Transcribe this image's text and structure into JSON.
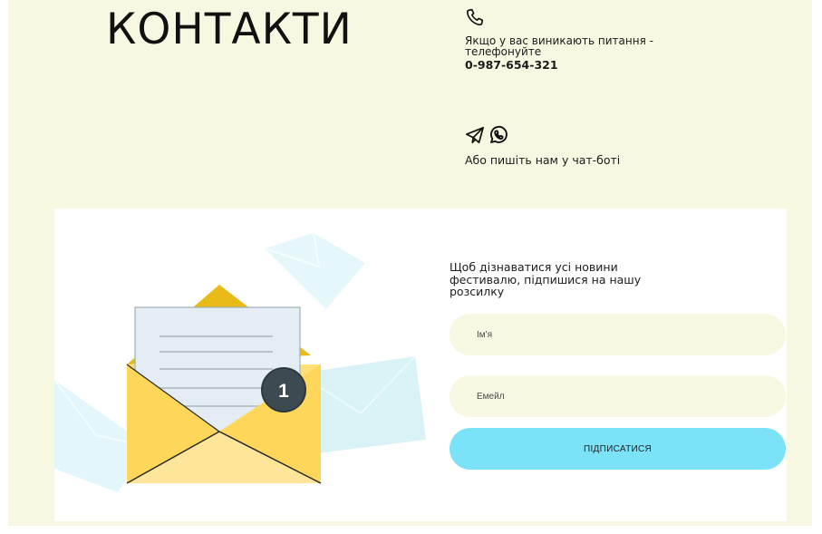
{
  "page": {
    "title": "КОНТАКТИ"
  },
  "contacts": {
    "phone_icon": "phone-icon",
    "phone_text_line1": "Якщо у вас виникають питання -",
    "phone_text_line2": "телефонуйте",
    "phone_number": "0-987-654-321",
    "chat_icons": [
      "telegram-icon",
      "whatsapp-icon"
    ],
    "chat_text": "Або пишіть нам у чат-боті"
  },
  "newsletter": {
    "text_line1": "Щоб дізнаватися усі новини",
    "text_line2": "фестивалю, підпишися на нашу",
    "text_line3": "розсилку",
    "name_placeholder": "Ім'я",
    "email_placeholder": "Емейл",
    "subscribe_label": "ПІДПИСАТИСЯ",
    "badge_count": "1"
  },
  "colors": {
    "page_background": "#f8f7e1",
    "card_background": "#ffffff",
    "input_background": "#f8f7e1",
    "button_background": "#7be2f8",
    "envelope_yellow": "#fde07a",
    "badge_background": "#3d4a51"
  }
}
